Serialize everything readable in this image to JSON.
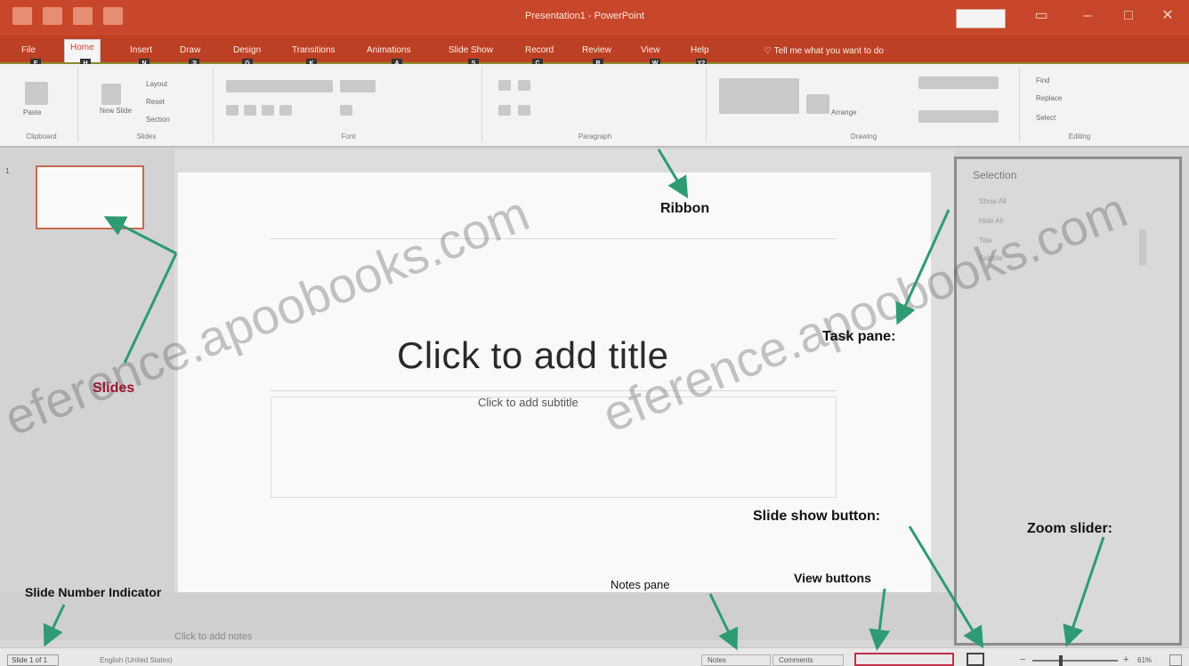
{
  "colors": {
    "brand": "#c8462a",
    "ribbon_bg": "#f3f3f3",
    "arrow": "#2e9b72",
    "annotation_red": "#9b1631"
  },
  "titlebar": {
    "title": "Presentation1 - PowerPoint"
  },
  "tabs": [
    {
      "label": "File"
    },
    {
      "label": "Home"
    },
    {
      "label": "Insert"
    },
    {
      "label": "Draw"
    },
    {
      "label": "Design"
    },
    {
      "label": "Transitions"
    },
    {
      "label": "Animations"
    },
    {
      "label": "Slide Show"
    },
    {
      "label": "Record"
    },
    {
      "label": "Review"
    },
    {
      "label": "View"
    },
    {
      "label": "Help"
    }
  ],
  "tellme": {
    "label": "Tell me what you want to do"
  },
  "keytips": [
    "F",
    "H",
    "N",
    "JI",
    "G",
    "K",
    "A",
    "S",
    "C",
    "R",
    "W",
    "Y2"
  ],
  "ribbon": {
    "groups": [
      {
        "label": "Clipboard",
        "buttons": [
          "Paste"
        ]
      },
      {
        "label": "Slides",
        "buttons": [
          "New Slide",
          "Layout",
          "Reset",
          "Section"
        ]
      },
      {
        "label": "Font",
        "buttons": []
      },
      {
        "label": "Paragraph",
        "buttons": [
          "Arrange"
        ]
      },
      {
        "label": "Drawing",
        "buttons": []
      },
      {
        "label": "Editing",
        "buttons": [
          "Find",
          "Replace",
          "Select"
        ]
      }
    ]
  },
  "thumbnails": {
    "slide_number": "1"
  },
  "slide": {
    "title_placeholder": "Click to add title",
    "subtitle_placeholder": "Click to add subtitle"
  },
  "taskpane": {
    "title": "Selection",
    "lines": [
      "Show All",
      "Hide All",
      "Title",
      "Subtitle"
    ]
  },
  "notes": {
    "placeholder": "Click to add notes"
  },
  "statusbar": {
    "slide_indicator": "Slide 1 of 1",
    "language": "English (United States)",
    "notes_button": "Notes",
    "comments_button": "Comments",
    "zoom_minus": "−",
    "zoom_plus": "+",
    "zoom_percent": "61%"
  },
  "annotations": {
    "ribbon": "Ribbon",
    "slides": "Slides",
    "task_pane": "Task pane:",
    "slide_show_button": "Slide show button:",
    "zoom_slider": "Zoom slider:",
    "slide_number_indicator": "Slide Number Indicator",
    "notes_pane": "Notes pane",
    "view_buttons": "View buttons"
  },
  "watermark": {
    "text": "eference.apoobooks.com"
  }
}
